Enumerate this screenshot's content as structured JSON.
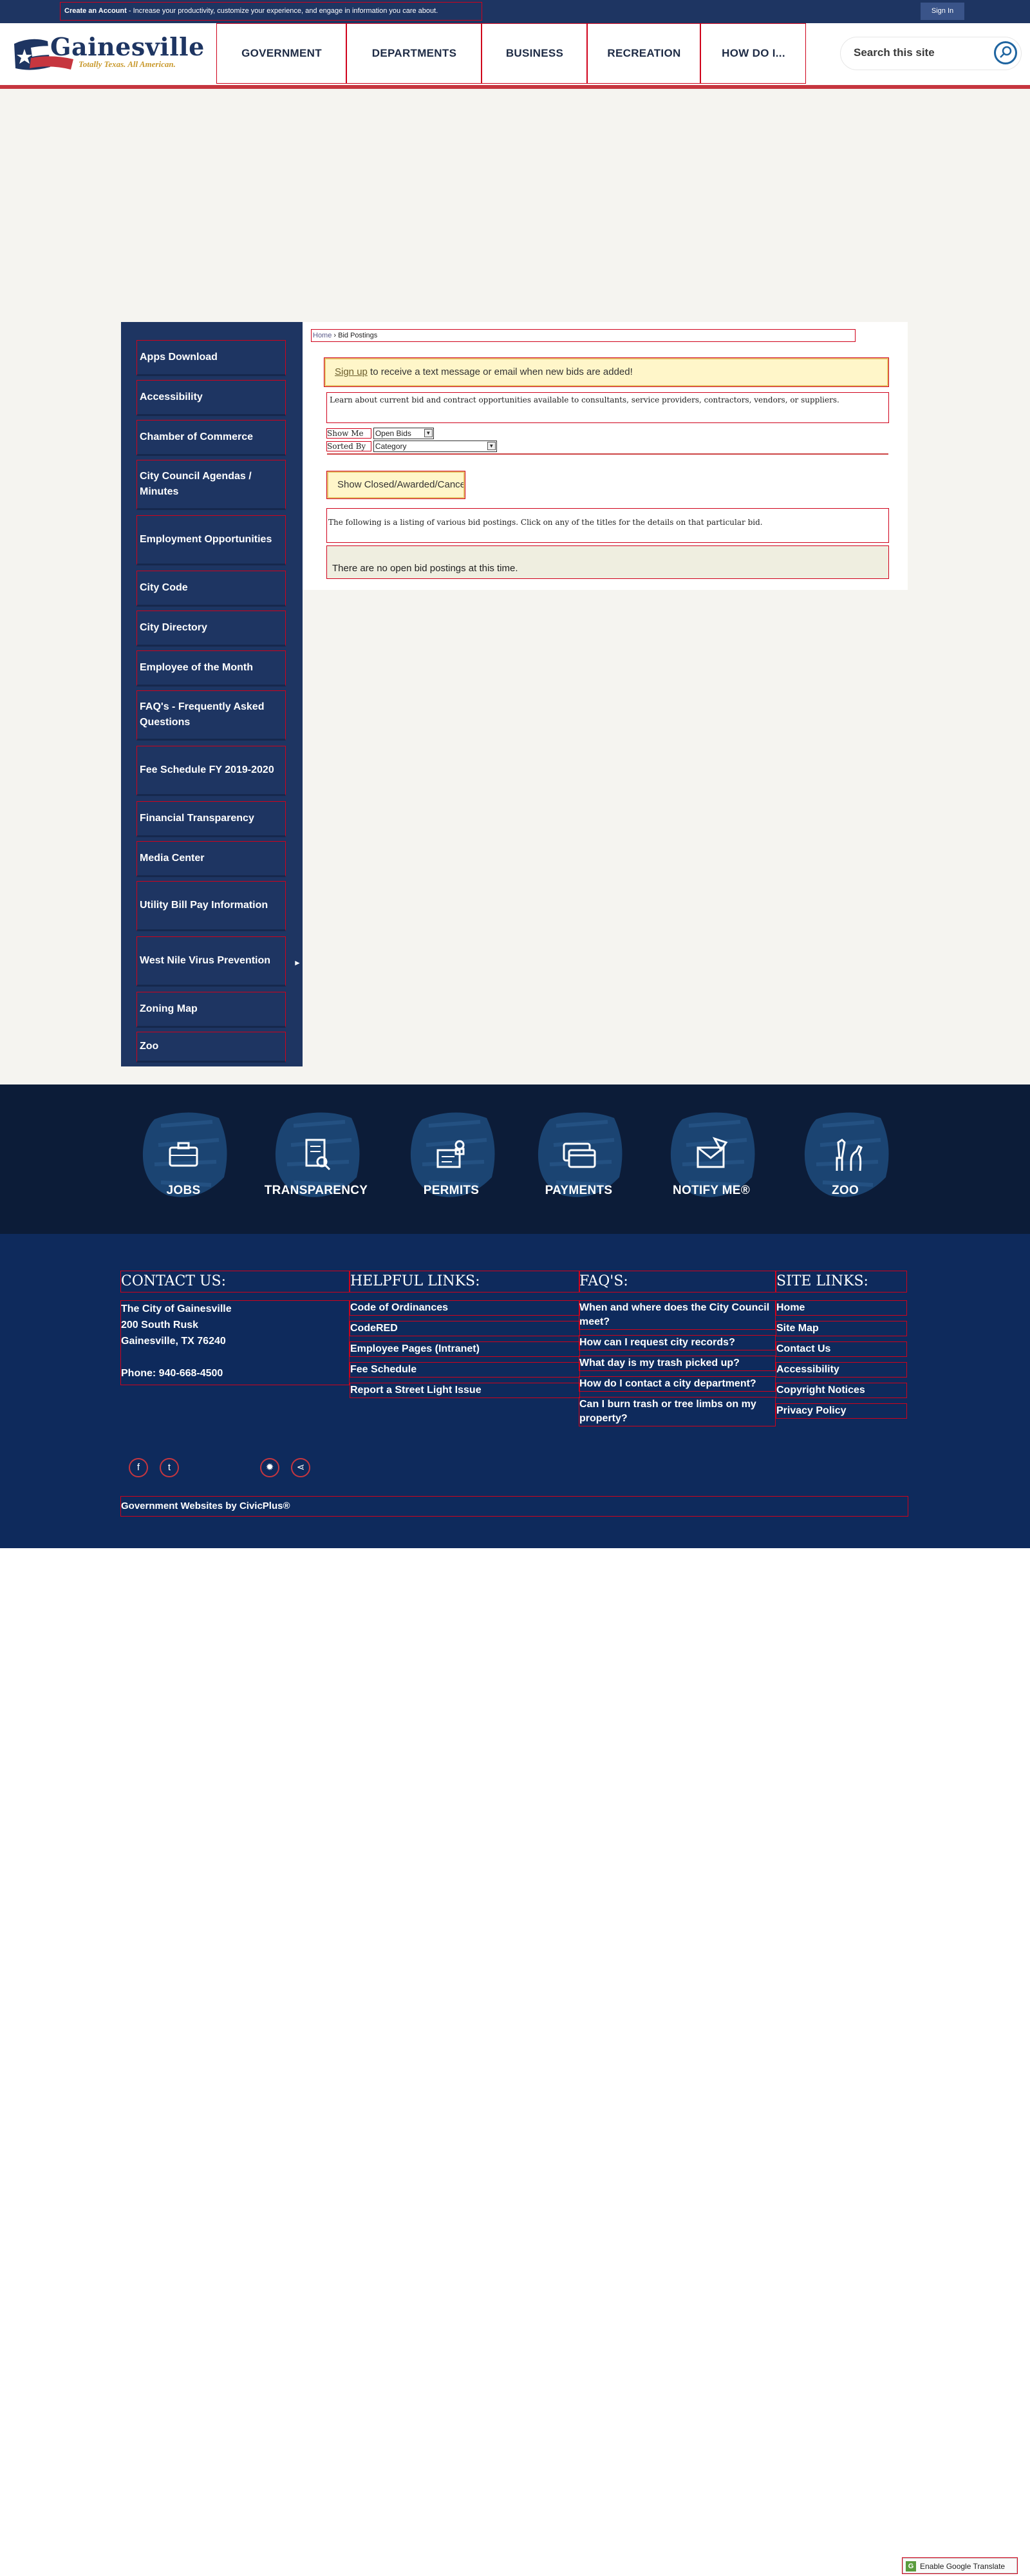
{
  "topbar": {
    "create_account_bold": "Create an Account",
    "create_account_text": " - Increase your productivity, customize your experience, and engage in information you care about.",
    "sign_in": "Sign In"
  },
  "header": {
    "logo_name": "Gainesville",
    "logo_tagline": "Totally Texas. All American.",
    "nav": [
      "GOVERNMENT",
      "DEPARTMENTS",
      "BUSINESS",
      "RECREATION",
      "HOW DO I..."
    ],
    "search_placeholder": "Search this site",
    "colors": {
      "navy": "#1e3562",
      "accent_red": "#c6363f"
    }
  },
  "sidebar": {
    "items": [
      "Apps Download",
      "Accessibility",
      "Chamber of Commerce",
      "City Council Agendas / Minutes",
      "Employment Opportunities",
      "City Code",
      "City Directory",
      "Employee of the Month",
      "FAQ's - Frequently Asked Questions",
      "Fee Schedule FY 2019-2020",
      "Financial Transparency",
      "Media Center",
      "Utility Bill Pay Information",
      "West Nile Virus Prevention",
      "Zoning Map",
      "Zoo"
    ]
  },
  "content": {
    "breadcrumb_home": "Home",
    "breadcrumb_sep": " › ",
    "breadcrumb_current": "Bid Postings",
    "notice_link": "Sign up",
    "notice_text": " to receive a text message or email when new bids are added!",
    "learn_text": "Learn about current bid and contract opportunities available to consultants, service providers, contractors, vendors, or suppliers.",
    "show_me_label": "Show Me",
    "show_me_value": "Open Bids",
    "sorted_by_label": "Sorted By",
    "sorted_by_value": "Category",
    "closed_button": "Show Closed/Awarded/Cancelled Bids",
    "listing_text": "The following is a listing of various bid postings. Click on any of the titles for the details on that particular bid.",
    "no_bids_text": "There are no open bid postings at this time."
  },
  "quick_links": [
    "JOBS",
    "TRANSPARENCY",
    "PERMITS",
    "PAYMENTS",
    "NOTIFY ME®",
    "ZOO"
  ],
  "footer": {
    "contact_heading": "CONTACT US:",
    "contact_lines": [
      "The City of Gainesville",
      "200 South Rusk",
      "Gainesville, TX 76240",
      "",
      "Phone: 940-668-4500"
    ],
    "helpful_heading": "HELPFUL LINKS:",
    "helpful_links": [
      "Code of Ordinances",
      "CodeRED",
      "Employee Pages (Intranet)",
      "Fee Schedule",
      "Report a Street Light Issue"
    ],
    "faq_heading": "FAQ'S:",
    "faq_links": [
      "When and where does the City Council meet?",
      "How can I request city records?",
      "What day is my trash picked up?",
      "How do I contact a city department?",
      "Can I burn trash or tree limbs on my property?"
    ],
    "site_heading": "SITE LINKS:",
    "site_links": [
      "Home",
      "Site Map",
      "Contact Us",
      "Accessibility",
      "Copyright Notices",
      "Privacy Policy"
    ],
    "civicplus": "Government Websites by CivicPlus®"
  },
  "translate": {
    "label": "Enable Google Translate"
  }
}
